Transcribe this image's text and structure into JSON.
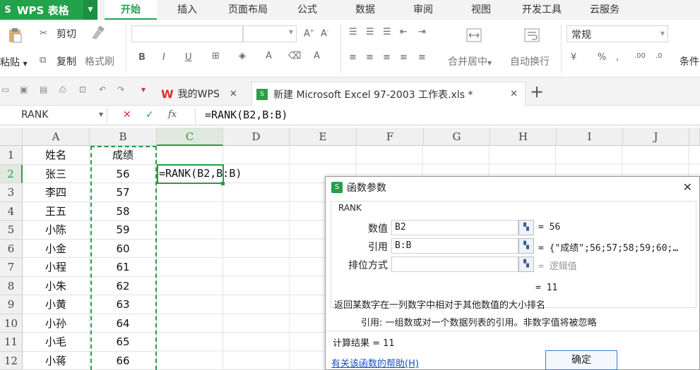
{
  "menu": {
    "app_title": "WPS 表格",
    "tabs": [
      "开始",
      "插入",
      "页面布局",
      "公式",
      "数据",
      "审阅",
      "视图",
      "开发工具",
      "云服务"
    ]
  },
  "ribbon": {
    "paste": "粘贴",
    "cut": "剪切",
    "copy": "复制",
    "format_painter": "格式刷",
    "merge_center": "合并居中",
    "wrap_text": "自动换行",
    "number_format": "常规",
    "conditional": "条件"
  },
  "tabs_bar": {
    "wps_tab": "我的WPS",
    "doc_tab": "新建 Microsoft Excel 97-2003 工作表.xls *"
  },
  "formula_bar": {
    "name_box": "RANK",
    "fx": "fx",
    "formula": "=RANK(B2,B:B)"
  },
  "sheet": {
    "columns": [
      "A",
      "B",
      "C",
      "D",
      "E",
      "F",
      "G",
      "H",
      "I",
      "J"
    ],
    "rows": [
      "1",
      "2",
      "3",
      "4",
      "5",
      "6",
      "7",
      "8",
      "9",
      "10",
      "11",
      "12"
    ],
    "header_a": "姓名",
    "header_b": "成绩",
    "names": [
      "张三",
      "李四",
      "王五",
      "小陈",
      "小金",
      "小程",
      "小朱",
      "小黄",
      "小孙",
      "小毛",
      "小蒋"
    ],
    "scores": [
      "56",
      "57",
      "58",
      "59",
      "60",
      "61",
      "62",
      "63",
      "64",
      "65",
      "66"
    ],
    "c2_formula": "=RANK(B2,B:B)"
  },
  "dialog": {
    "title": "函数参数",
    "function_name": "RANK",
    "args": [
      {
        "label": "数值",
        "value": "B2",
        "result": "= 56"
      },
      {
        "label": "引用",
        "value": "B:B",
        "result": "= {\"成绩\";56;57;58;59;60;…"
      },
      {
        "label": "排位方式",
        "value": "",
        "result": "= 逻辑值"
      }
    ],
    "formula_result": "= 11",
    "description": "返回某数字在一列数字中相对于其他数值的大小排名",
    "arg_description": "引用: 一组数或对一个数据列表的引用。非数字值将被忽略",
    "calc_result": "计算结果 = 11",
    "help_link": "有关该函数的帮助(H)",
    "ok_button": "确定",
    "close": "✕"
  },
  "colors": {
    "brand": "#22a24b",
    "selection_border": "#2a9a4a",
    "link": "#1a4fc0"
  }
}
